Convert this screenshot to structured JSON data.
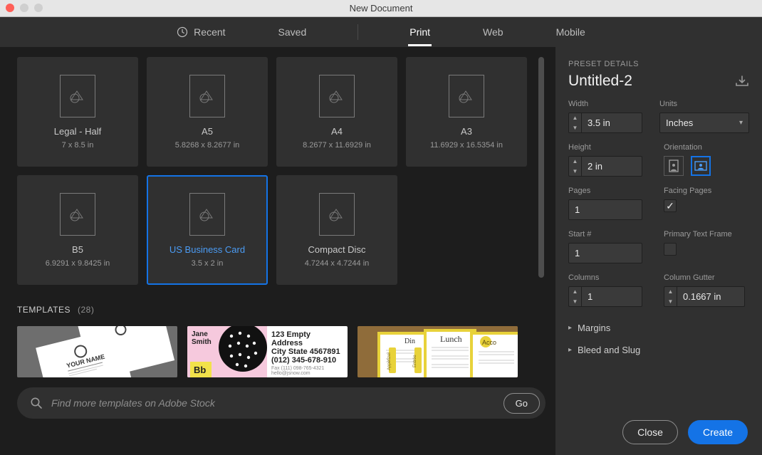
{
  "window": {
    "title": "New Document"
  },
  "tabs": {
    "recent": "Recent",
    "saved": "Saved",
    "print": "Print",
    "web": "Web",
    "mobile": "Mobile",
    "active": "print"
  },
  "presets": [
    {
      "name": "Legal - Half",
      "dim": "7 x 8.5 in"
    },
    {
      "name": "A5",
      "dim": "5.8268 x 8.2677 in"
    },
    {
      "name": "A4",
      "dim": "8.2677 x 11.6929 in"
    },
    {
      "name": "A3",
      "dim": "11.6929 x 16.5354 in"
    },
    {
      "name": "B5",
      "dim": "6.9291 x 9.8425 in"
    },
    {
      "name": "US Business Card",
      "dim": "3.5 x 2 in",
      "selected": true
    },
    {
      "name": "Compact Disc",
      "dim": "4.7244 x 4.7244 in"
    }
  ],
  "templates": {
    "label": "TEMPLATES",
    "count": "(28)",
    "t1": {
      "name": "Jane\nSmith",
      "addr1": "123 Empty Address",
      "addr2": "City State 4567891",
      "phone": "(012) 345-678-910"
    },
    "t2": {
      "word": "Lunch"
    }
  },
  "search": {
    "placeholder": "Find more templates on Adobe Stock",
    "go": "Go"
  },
  "panel": {
    "header": "Preset Details",
    "title": "Untitled-2",
    "width_label": "Width",
    "width": "3.5 in",
    "units_label": "Units",
    "units": "Inches",
    "height_label": "Height",
    "height": "2 in",
    "orientation_label": "Orientation",
    "pages_label": "Pages",
    "pages": "1",
    "facing_label": "Facing Pages",
    "facing_checked": true,
    "start_label": "Start #",
    "start": "1",
    "ptf_label": "Primary Text Frame",
    "ptf_checked": false,
    "columns_label": "Columns",
    "columns": "1",
    "gutter_label": "Column Gutter",
    "gutter": "0.1667 in",
    "margins_label": "Margins",
    "bleed_label": "Bleed and Slug"
  },
  "footer": {
    "close": "Close",
    "create": "Create"
  }
}
